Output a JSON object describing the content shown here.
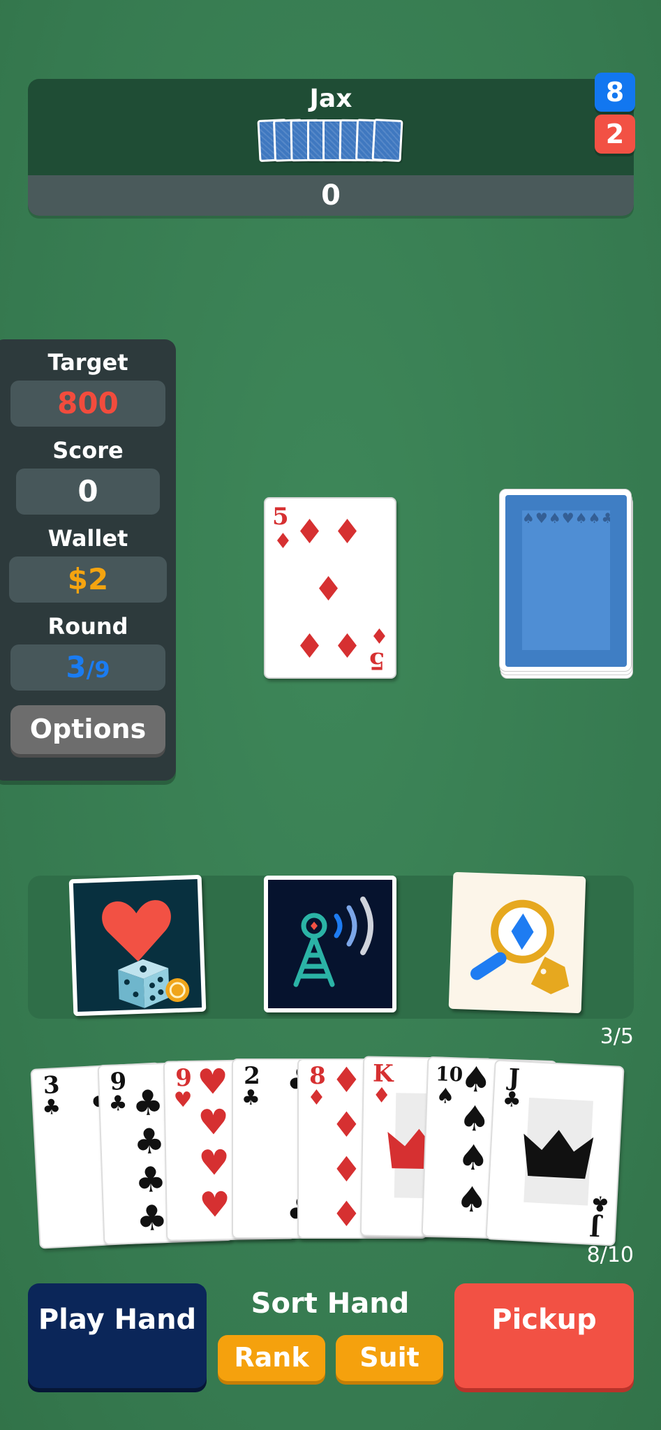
{
  "opponent": {
    "name": "Jax",
    "score": "0",
    "badge_blue": "8",
    "badge_red": "2"
  },
  "stats": {
    "target_label": "Target",
    "target_value": "800",
    "score_label": "Score",
    "score_value": "0",
    "wallet_label": "Wallet",
    "wallet_value": "$2",
    "round_label": "Round",
    "round_current": "3",
    "round_sep": "/",
    "round_total": "9",
    "options_label": "Options"
  },
  "table": {
    "top_card": {
      "rank": "5",
      "suit": "♦",
      "color": "#d63031"
    },
    "deck_pattern": "♠♥♠♥♠♠♣♠♣♠♥♠♥♠♥♣♠♣♠♣♠♥♠♥♠♣♠♣♠♣♥♠♥♠♥♣♠♣♠♣"
  },
  "jokers": {
    "count": "3/5",
    "items": [
      {
        "name": "heart-dice-joker"
      },
      {
        "name": "signal-tower-joker"
      },
      {
        "name": "magnifier-diamond-joker"
      }
    ]
  },
  "hand": {
    "count": "8/10",
    "cards": [
      {
        "rank": "3",
        "suit": "♣",
        "color": "#111111"
      },
      {
        "rank": "9",
        "suit": "♣",
        "color": "#111111"
      },
      {
        "rank": "9",
        "suit": "♥",
        "color": "#d63031"
      },
      {
        "rank": "2",
        "suit": "♣",
        "color": "#111111"
      },
      {
        "rank": "8",
        "suit": "♦",
        "color": "#d63031"
      },
      {
        "rank": "K",
        "suit": "♦",
        "color": "#d63031"
      },
      {
        "rank": "10",
        "suit": "♠",
        "color": "#111111"
      },
      {
        "rank": "J",
        "suit": "♣",
        "color": "#111111"
      }
    ]
  },
  "controls": {
    "play_label": "Play Hand",
    "sort_label": "Sort Hand",
    "rank_label": "Rank",
    "suit_label": "Suit",
    "pickup_label": "Pickup"
  },
  "colors": {
    "felt": "#3a8055",
    "accent_red": "#f25144",
    "accent_blue": "#1277f0",
    "accent_orange": "#f5a10d",
    "play_button": "#0b2659"
  }
}
